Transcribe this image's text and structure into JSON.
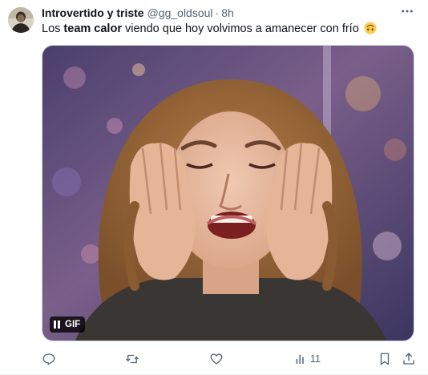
{
  "tweet": {
    "author": {
      "display_name": "Introvertido y triste",
      "handle": "@gg_oldsoul",
      "separator": "·",
      "time": "8h",
      "avatar_icon": "avatar-image"
    },
    "text": {
      "part1": "Los ",
      "bold": "team calor",
      "part2": " viendo que hoy volvimos a amanecer con frío",
      "emoji": "upside-down-face-emoji"
    },
    "media": {
      "type": "gif",
      "badge_label": "GIF",
      "badge_icon": "pause-icon"
    },
    "actions": {
      "reply_icon": "reply-icon",
      "retweet_icon": "retweet-icon",
      "like_icon": "heart-icon",
      "views_icon": "analytics-icon",
      "views_count": "11",
      "bookmark_icon": "bookmark-icon",
      "share_icon": "share-icon"
    },
    "more_icon": "more-icon"
  },
  "colors": {
    "text_primary": "#0f1419",
    "text_secondary": "#536471",
    "border": "#cfd9de"
  }
}
